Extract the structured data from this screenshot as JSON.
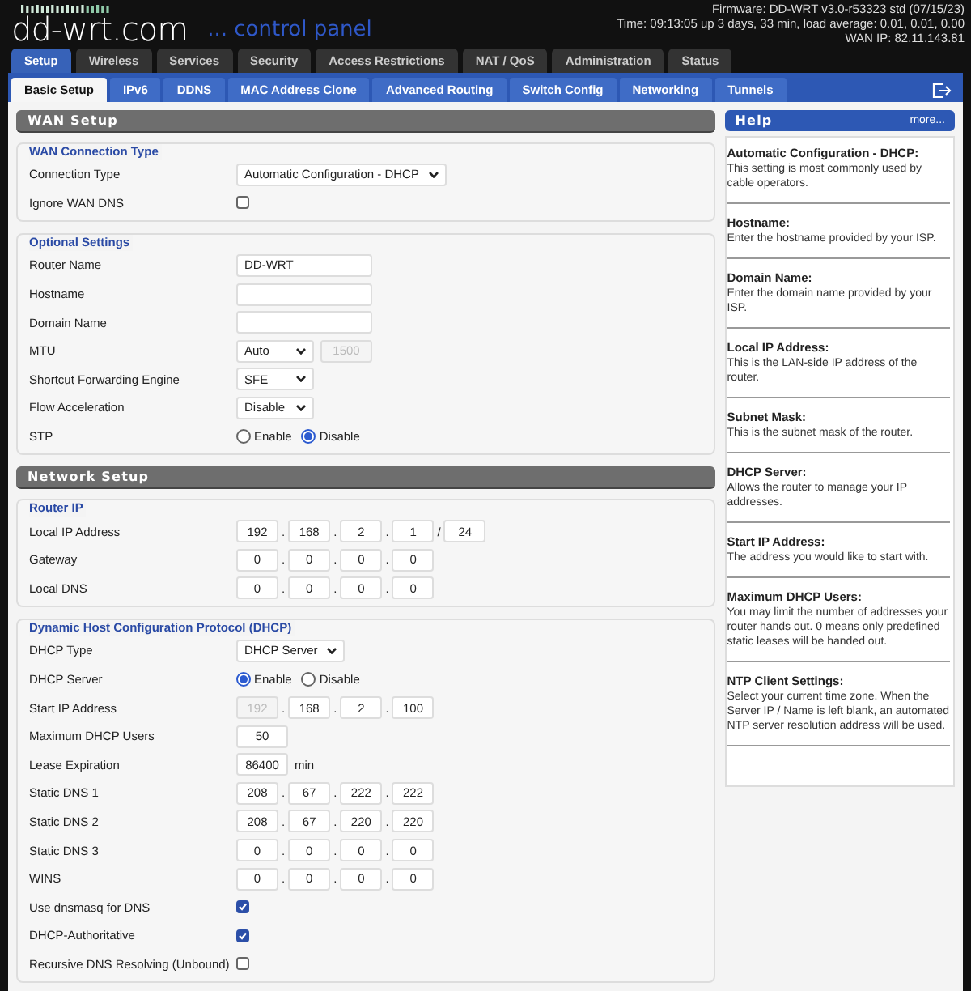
{
  "header": {
    "logo": "dd-wrt",
    "logo_suffix": ".com",
    "tagline": "... control panel",
    "firmware": "Firmware: DD-WRT v3.0-r53323 std (07/15/23)",
    "time": "Time: 09:13:05 up 3 days, 33 min, load average: 0.01, 0.01, 0.00",
    "wan_ip": "WAN IP: 82.11.143.81"
  },
  "main_tabs": [
    {
      "label": "Setup",
      "selected": true
    },
    {
      "label": "Wireless",
      "selected": false
    },
    {
      "label": "Services",
      "selected": false
    },
    {
      "label": "Security",
      "selected": false
    },
    {
      "label": "Access Restrictions",
      "selected": false
    },
    {
      "label": "NAT / QoS",
      "selected": false
    },
    {
      "label": "Administration",
      "selected": false
    },
    {
      "label": "Status",
      "selected": false
    }
  ],
  "sub_tabs": [
    {
      "label": "Basic Setup",
      "selected": true
    },
    {
      "label": "IPv6",
      "selected": false
    },
    {
      "label": "DDNS",
      "selected": false
    },
    {
      "label": "MAC Address Clone",
      "selected": false
    },
    {
      "label": "Advanced Routing",
      "selected": false
    },
    {
      "label": "Switch Config",
      "selected": false
    },
    {
      "label": "Networking",
      "selected": false
    },
    {
      "label": "Tunnels",
      "selected": false
    }
  ],
  "sections": [
    {
      "title": "WAN Setup",
      "groups": [
        {
          "legend": "WAN Connection Type",
          "rows": [
            {
              "label": "Connection Type",
              "kind": "select",
              "value": "Automatic Configuration - DHCP"
            },
            {
              "label": "Ignore WAN DNS",
              "kind": "checkbox",
              "checked": false
            }
          ]
        },
        {
          "legend": "Optional Settings",
          "rows": [
            {
              "label": "Router Name",
              "kind": "text",
              "value": "DD-WRT"
            },
            {
              "label": "Hostname",
              "kind": "text"
            },
            {
              "label": "Domain Name",
              "kind": "text"
            },
            {
              "label": "MTU",
              "kind": "select_number",
              "value": "Auto",
              "number": "1500",
              "number_disabled": true
            },
            {
              "label": "Shortcut Forwarding Engine",
              "kind": "select",
              "value": "SFE"
            },
            {
              "label": "Flow Acceleration",
              "kind": "select",
              "value": "Disable"
            },
            {
              "label": "STP",
              "kind": "radio",
              "options": [
                {
                  "label": "Enable",
                  "selected": false
                },
                {
                  "label": "Disable",
                  "selected": true
                }
              ]
            }
          ]
        }
      ]
    },
    {
      "title": "Network Setup",
      "groups": [
        {
          "legend": "Router IP",
          "rows": [
            {
              "label": "Local IP Address",
              "kind": "ip",
              "octets": [
                "192",
                "168",
                "2",
                "1"
              ],
              "separator": ".",
              "first_octet_disabled": false,
              "mask_separator": "/",
              "mask": "24"
            },
            {
              "label": "Gateway",
              "kind": "ip",
              "octets": [
                "0",
                "0",
                "0",
                "0"
              ],
              "separator": ".",
              "first_octet_disabled": false
            },
            {
              "label": "Local DNS",
              "kind": "ip",
              "octets": [
                "0",
                "0",
                "0",
                "0"
              ],
              "separator": ".",
              "first_octet_disabled": false
            }
          ]
        },
        {
          "legend": "Dynamic Host Configuration Protocol (DHCP)",
          "rows": [
            {
              "label": "DHCP Type",
              "kind": "select",
              "value": "DHCP Server"
            },
            {
              "label": "DHCP Server",
              "kind": "radio",
              "options": [
                {
                  "label": "Enable",
                  "selected": true
                },
                {
                  "label": "Disable",
                  "selected": false
                }
              ]
            },
            {
              "label": "Start IP Address",
              "kind": "ip",
              "octets": [
                "192",
                "168",
                "2",
                "100"
              ],
              "separator": ".",
              "first_octet_disabled": true
            },
            {
              "label": "Maximum DHCP Users",
              "kind": "number",
              "value": "50"
            },
            {
              "label": "Lease Expiration",
              "kind": "number_unit",
              "value": "86400",
              "unit": "min"
            },
            {
              "label": "Static DNS 1",
              "kind": "ip",
              "octets": [
                "208",
                "67",
                "222",
                "222"
              ],
              "separator": ".",
              "first_octet_disabled": false
            },
            {
              "label": "Static DNS 2",
              "kind": "ip",
              "octets": [
                "208",
                "67",
                "220",
                "220"
              ],
              "separator": ".",
              "first_octet_disabled": false
            },
            {
              "label": "Static DNS 3",
              "kind": "ip",
              "octets": [
                "0",
                "0",
                "0",
                "0"
              ],
              "separator": ".",
              "first_octet_disabled": false
            },
            {
              "label": "WINS",
              "kind": "ip",
              "octets": [
                "0",
                "0",
                "0",
                "0"
              ],
              "separator": ".",
              "first_octet_disabled": false
            },
            {
              "label": "Use dnsmasq for DNS",
              "kind": "checkbox",
              "checked": true
            },
            {
              "label": "DHCP-Authoritative",
              "kind": "checkbox",
              "checked": true
            },
            {
              "label": "Recursive DNS Resolving (Unbound)",
              "kind": "checkbox",
              "checked": false
            }
          ]
        }
      ]
    }
  ],
  "help": {
    "title": "Help",
    "more": "more...",
    "entries": [
      {
        "title": "Automatic Configuration - DHCP:",
        "text": "This setting is most commonly used by cable operators."
      },
      {
        "title": "Hostname:",
        "text": "Enter the hostname provided by your ISP."
      },
      {
        "title": "Domain Name:",
        "text": "Enter the domain name provided by your ISP."
      },
      {
        "title": "Local IP Address:",
        "text": "This is the LAN-side IP address of the router."
      },
      {
        "title": "Subnet Mask:",
        "text": "This is the subnet mask of the router."
      },
      {
        "title": "DHCP Server:",
        "text": "Allows the router to manage your IP addresses."
      },
      {
        "title": "Start IP Address:",
        "text": "The address you would like to start with."
      },
      {
        "title": "Maximum DHCP Users:",
        "text": "You may limit the number of addresses your router hands out. 0 means only predefined static leases will be handed out."
      },
      {
        "title": "NTP Client Settings:",
        "text": "Select your current time zone. When the Server IP / Name is left blank, an automated NTP server resolution address will be used."
      }
    ]
  }
}
